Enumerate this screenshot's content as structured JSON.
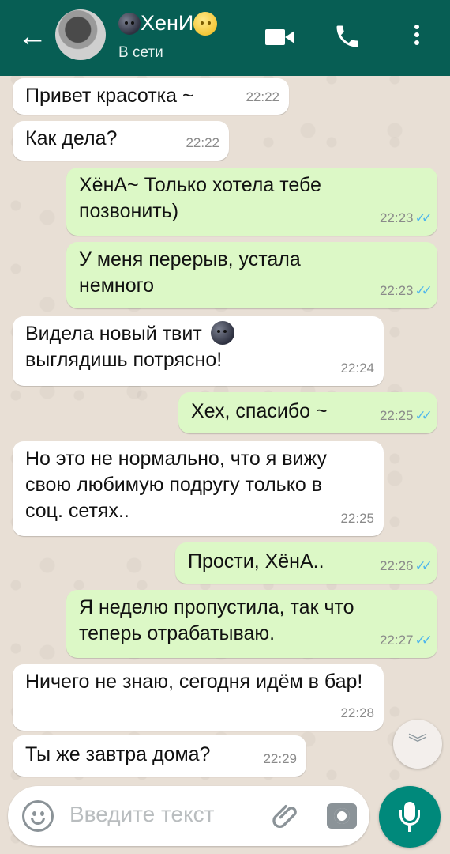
{
  "header": {
    "back_glyph": "←",
    "contact_name": "ХенИ",
    "status": "В сети",
    "icons": [
      "back-arrow-icon",
      "new-moon-face-emoji",
      "full-moon-face-emoji",
      "video-call-icon",
      "phone-icon",
      "more-vert-icon"
    ]
  },
  "messages": [
    {
      "direction": "in",
      "text": "Привет красотка ~",
      "time": "22:22"
    },
    {
      "direction": "in",
      "text": "Как дела?",
      "time": "22:22"
    },
    {
      "direction": "out",
      "text": "ХёнА~ Только хотела тебе позвонить)",
      "time": "22:23",
      "read": true
    },
    {
      "direction": "out",
      "text": "У меня перерыв, устала немного",
      "time": "22:23",
      "read": true
    },
    {
      "direction": "in",
      "text_line1": "Видела новый твит",
      "text_line2": "выглядишь потрясно!",
      "emoji": "new-moon-face",
      "time": "22:24"
    },
    {
      "direction": "out",
      "text": "Хех, спасибо ~",
      "time": "22:25",
      "read": true
    },
    {
      "direction": "in",
      "text": "Но это не нормально, что я вижу свою любимую подругу только в соц. сетях..",
      "time": "22:25"
    },
    {
      "direction": "out",
      "text": "Прости, ХёнА..",
      "time": "22:26",
      "read": true
    },
    {
      "direction": "out",
      "text": "Я неделю пропустила, так что теперь отрабатываю.",
      "time": "22:27",
      "read": true
    },
    {
      "direction": "in",
      "text": "Ничего не знаю, сегодня идём в бар!",
      "time": "22:28"
    },
    {
      "direction": "in",
      "text": "Ты же завтра дома?",
      "time": "22:29"
    }
  ],
  "read_ticks": "✓✓",
  "scroll_down_glyph": "︾",
  "composer": {
    "placeholder": "Введите текст",
    "icons": [
      "emoji-icon",
      "attach-icon",
      "camera-icon",
      "mic-icon"
    ]
  },
  "colors": {
    "header": "#075e54",
    "outgoing_bubble": "#dcf8c6",
    "incoming_bubble": "#ffffff",
    "read_ticks": "#4fb6ec",
    "mic_button": "#00897b"
  }
}
